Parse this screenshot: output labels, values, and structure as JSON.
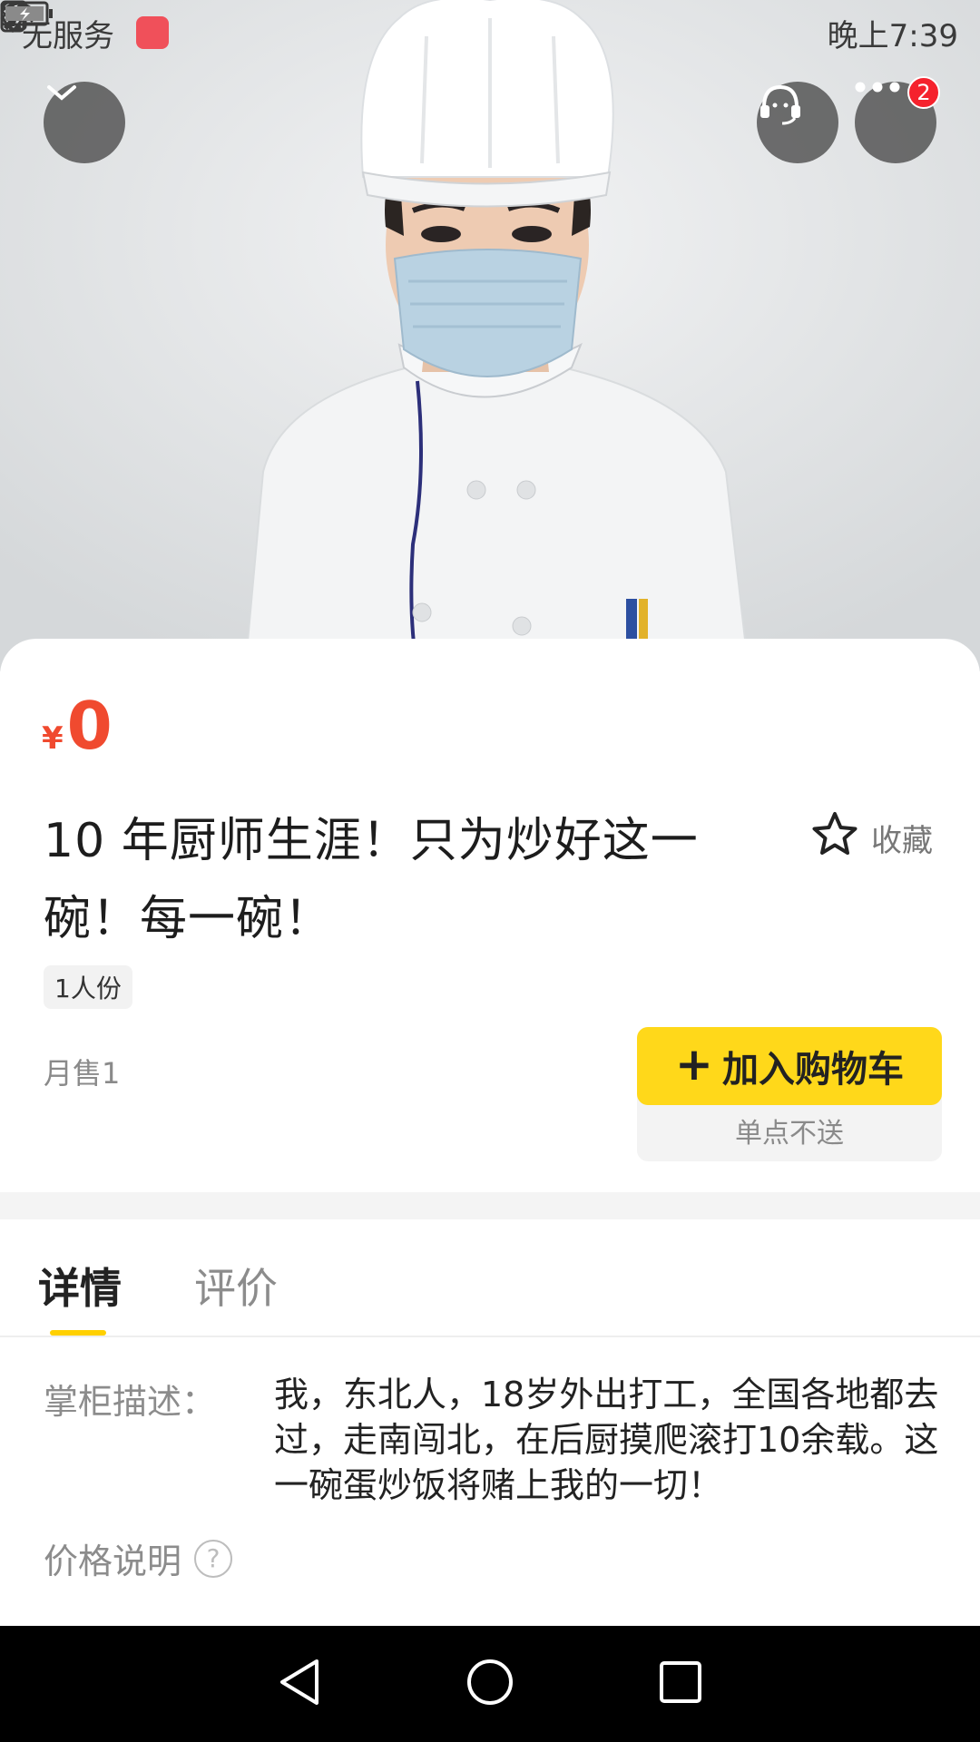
{
  "status_bar": {
    "carrier": "无服务",
    "time": "晚上7:39",
    "icons": [
      "key-icon",
      "huawei-app-icon",
      "location-icon",
      "vibrate-icon",
      "wifi-icon",
      "alert-icon",
      "battery-charging-icon"
    ]
  },
  "top_buttons": {
    "collapse_icon": "chevron-down-icon",
    "service_icon": "customer-service-icon",
    "more_icon": "more-dots-icon",
    "more_badge": "2"
  },
  "product": {
    "price_symbol": "¥",
    "price": "0",
    "title": "10 年厨师生涯！只为炒好这一碗！每一碗！",
    "favorite_label": "收藏",
    "tag": "1人份",
    "monthly_sales": "月售1",
    "add_to_cart_label": "加入购物车",
    "cart_note": "单点不送"
  },
  "tabs": [
    {
      "label": "详情",
      "active": true
    },
    {
      "label": "评价",
      "active": false
    }
  ],
  "details": {
    "desc_label": "掌柜描述：",
    "desc_text": "我，东北人，18岁外出打工，全国各地都去过，走南闯北，在后厨摸爬滚打10余载。这一碗蛋炒饭将赌上我的一切！",
    "price_note_label": "价格说明",
    "price_note_icon": "?"
  },
  "colors": {
    "price": "#f04a2f",
    "cart_button": "#ffd81a",
    "tab_underline": "#ffd000",
    "badge": "#f5222d"
  }
}
